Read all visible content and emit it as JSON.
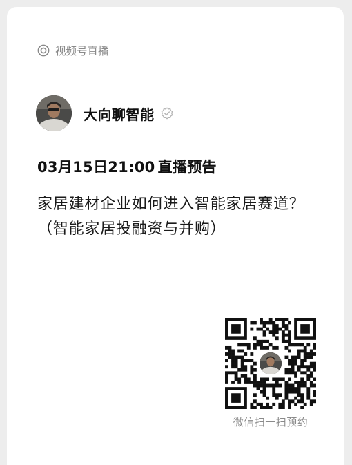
{
  "header": {
    "source_icon": "channels-live-icon",
    "source_label": "视频号直播"
  },
  "author": {
    "name": "大向聊智能",
    "verified_icon": "verified-badge-icon"
  },
  "schedule": {
    "date": "03月15日21:00",
    "label": "直播预告"
  },
  "topic": {
    "title": "家居建材企业如何进入智能家居赛道？（智能家居投融资与并购）"
  },
  "qr": {
    "caption": "微信扫一扫预约"
  },
  "colors": {
    "background": "#ededed",
    "card": "#ffffff",
    "muted_text": "#8a8a8a",
    "primary_text": "#111111"
  }
}
